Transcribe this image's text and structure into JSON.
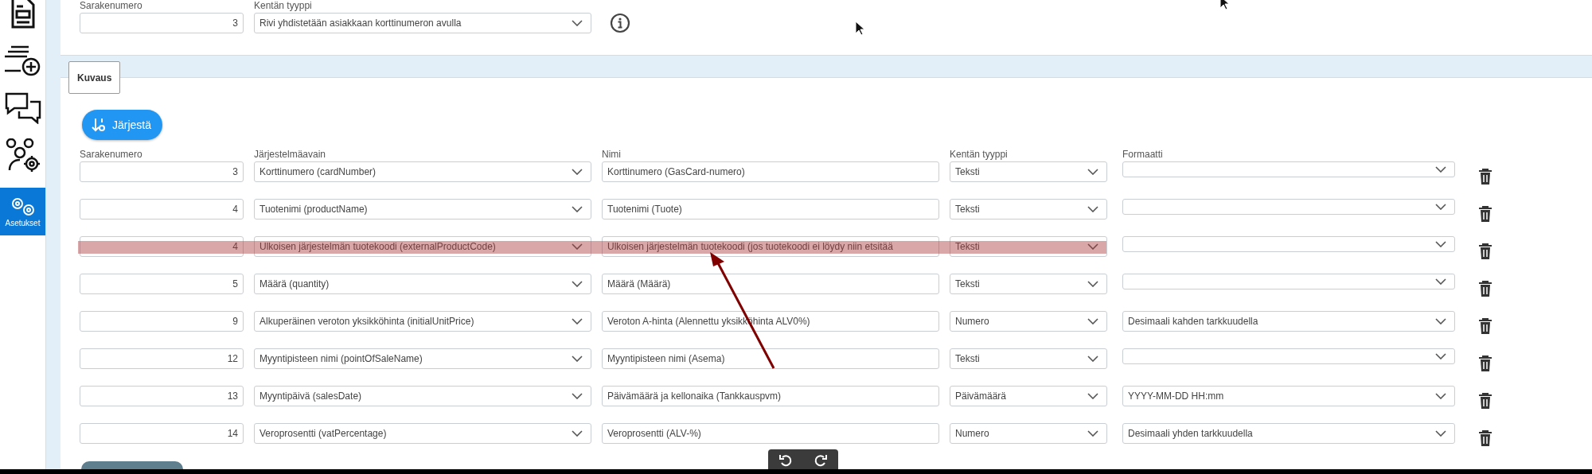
{
  "sidebar": {
    "items": [
      {
        "selected": false
      },
      {
        "selected": false
      },
      {
        "selected": false
      },
      {
        "selected": false
      },
      {
        "label": "Asetukset",
        "selected": true
      }
    ]
  },
  "top_row": {
    "number_label": "Sarakenumero",
    "number_value": "3",
    "type_label": "Kentän tyyppi",
    "type_value": "Rivi yhdistetään asiakkaan korttinumeron avulla"
  },
  "tabs": [
    {
      "label": "Kuvaus",
      "selected": true
    }
  ],
  "sort_button": "Järjestä",
  "columns": [
    "Sarakenumero",
    "Järjestelmäavain",
    "Nimi",
    "Kentän tyyppi",
    "Formaatti"
  ],
  "rows": [
    {
      "number": "3",
      "system_key": "Korttinumero (cardNumber)",
      "name": "Korttinumero (GasCard-numero)",
      "field_type": "Teksti",
      "format": "",
      "highlighted": false
    },
    {
      "number": "4",
      "system_key": "Tuotenimi (productName)",
      "name": "Tuotenimi (Tuote)",
      "field_type": "Teksti",
      "format": "",
      "highlighted": false
    },
    {
      "number": "4",
      "system_key": "Ulkoisen järjestelmän tuotekoodi (externalProductCode)",
      "name": "Ulkoisen järjestelmän tuotekoodi (jos tuotekoodi ei löydy niin etsitää",
      "field_type": "Teksti",
      "format": "",
      "highlighted": true
    },
    {
      "number": "5",
      "system_key": "Määrä (quantity)",
      "name": "Määrä (Määrä)",
      "field_type": "Teksti",
      "format": "",
      "highlighted": false
    },
    {
      "number": "9",
      "system_key": "Alkuperäinen veroton yksikköhinta (initialUnitPrice)",
      "name": "Veroton A-hinta (Alennettu yksikköhinta ALV0%)",
      "field_type": "Numero",
      "format": "Desimaali kahden tarkkuudella",
      "highlighted": false
    },
    {
      "number": "12",
      "system_key": "Myyntipisteen nimi (pointOfSaleName)",
      "name": "Myyntipisteen nimi (Asema)",
      "field_type": "Teksti",
      "format": "",
      "highlighted": false
    },
    {
      "number": "13",
      "system_key": "Myyntipäivä (salesDate)",
      "name": "Päivämäärä ja kellonaika (Tankkauspvm)",
      "field_type": "Päivämäärä",
      "format": "YYYY-MM-DD HH:mm",
      "highlighted": false
    },
    {
      "number": "14",
      "system_key": "Veroprosentti (vatPercentage)",
      "name": "Veroprosentti (ALV-%)",
      "field_type": "Numero",
      "format": "Desimaali yhden tarkkuudella",
      "highlighted": false
    }
  ]
}
